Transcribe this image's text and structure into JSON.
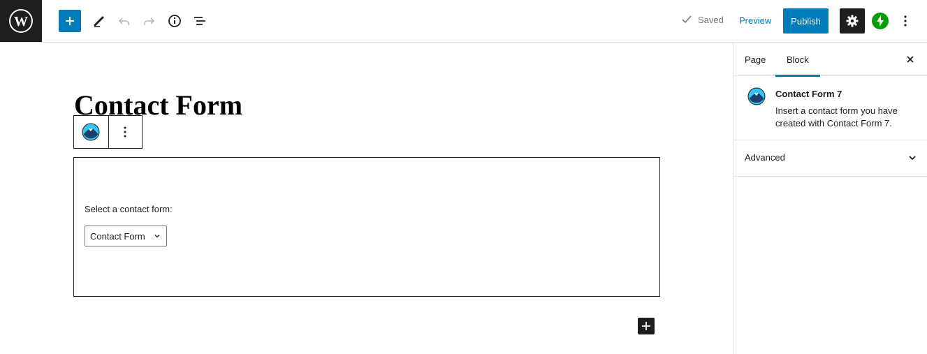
{
  "colors": {
    "accent": "#007cba",
    "dark": "#1e1e1e",
    "jetpack": "#069e08",
    "muted": "#757575"
  },
  "toolbar": {
    "logo_icon": "wordpress-icon",
    "inserter_icon": "plus-icon",
    "tools_icon": "pencil-icon",
    "undo_icon": "undo-icon",
    "redo_icon": "redo-icon",
    "details_icon": "info-icon",
    "outline_icon": "list-view-icon",
    "saved_label": "Saved",
    "preview_label": "Preview",
    "publish_label": "Publish",
    "settings_icon": "gear-icon",
    "jetpack_icon": "jetpack-icon",
    "more_icon": "vertical-ellipsis-icon"
  },
  "editor": {
    "title": "Contact Form",
    "block": {
      "label": "Select a contact form:",
      "selected_form": "Contact Form"
    }
  },
  "sidebar": {
    "tabs": [
      {
        "label": "Page"
      },
      {
        "label": "Block",
        "active": true
      }
    ],
    "block_card": {
      "title": "Contact Form 7",
      "description": "Insert a contact form you have created with Contact Form 7."
    },
    "panels": [
      {
        "title": "Advanced"
      }
    ]
  }
}
